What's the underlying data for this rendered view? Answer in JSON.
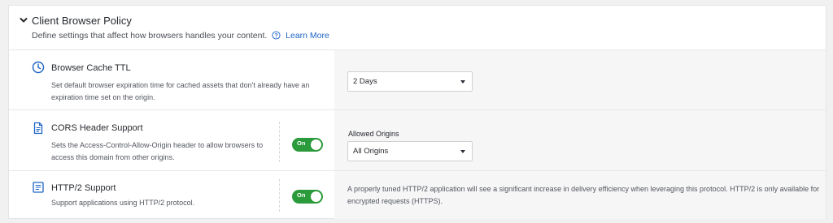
{
  "section": {
    "title": "Client Browser Policy",
    "description": "Define settings that affect how browsers handles your content.",
    "learn_more": "Learn More",
    "icons": {
      "collapse": "chevron-down-icon",
      "help": "help-circle-icon"
    }
  },
  "rows": [
    {
      "icon": "clock-icon",
      "title": "Browser Cache TTL",
      "description": "Set default browser expiration time for cached assets that don't already have an expiration time set on the origin.",
      "select_value": "2 Days"
    },
    {
      "icon": "document-icon",
      "title": "CORS Header Support",
      "description": "Sets the Access-Control-Allow-Origin header to allow browsers to access this domain from other origins.",
      "toggle_label": "On",
      "field_label": "Allowed Origins",
      "select_value": "All Origins"
    },
    {
      "icon": "list-icon",
      "title": "HTTP/2 Support",
      "description": "Support applications using HTTP/2 protocol.",
      "toggle_label": "On",
      "info": "A properly tuned HTTP/2 application will see a significant increase in delivery efficiency when leveraging this protocol. HTTP/2 is only available for encrypted requests (HTTPS)."
    }
  ],
  "colors": {
    "toggle_on": "#2a9a3a",
    "link": "#1d64c7"
  }
}
